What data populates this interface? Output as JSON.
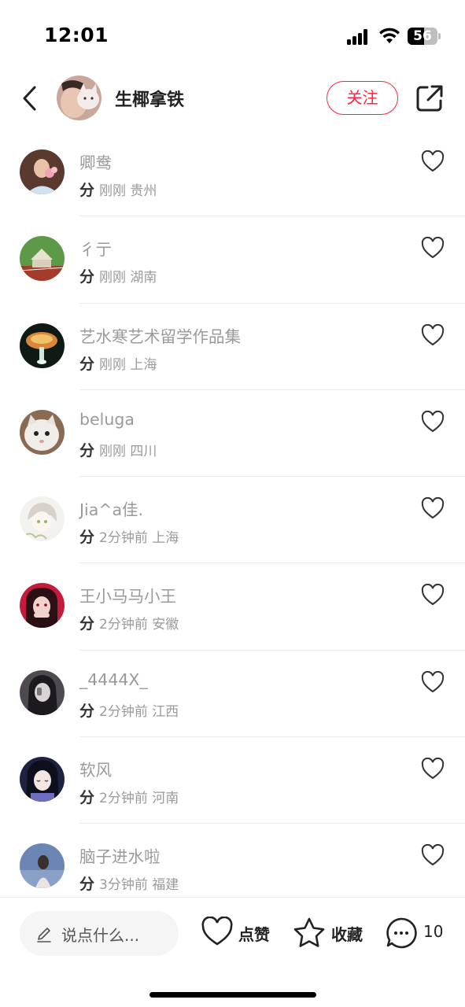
{
  "status_bar": {
    "time": "12:01",
    "battery": "56",
    "battery_level": 0.56
  },
  "header": {
    "username": "生椰拿铁",
    "follow_label": "关注"
  },
  "likes": [
    {
      "name": "卿鸯",
      "action": "分",
      "time": "刚刚",
      "location": "贵州"
    },
    {
      "name": "彳亍",
      "action": "分",
      "time": "刚刚",
      "location": "湖南"
    },
    {
      "name": "艺水寒艺术留学作品集",
      "action": "分",
      "time": "刚刚",
      "location": "上海"
    },
    {
      "name": "beluga",
      "action": "分",
      "time": "刚刚",
      "location": "四川"
    },
    {
      "name": "Jia^a佳.",
      "action": "分",
      "time": "2分钟前",
      "location": "上海"
    },
    {
      "name": "王小马马小王",
      "action": "分",
      "time": "2分钟前",
      "location": "安徽"
    },
    {
      "name": "_4444X_",
      "action": "分",
      "time": "2分钟前",
      "location": "江西"
    },
    {
      "name": "软风",
      "action": "分",
      "time": "2分钟前",
      "location": "河南"
    },
    {
      "name": "脑子进水啦",
      "action": "分",
      "time": "3分钟前",
      "location": "福建"
    }
  ],
  "bottom_bar": {
    "comment_placeholder": "说点什么...",
    "like_label": "点赞",
    "collect_label": "收藏",
    "comment_count": "10"
  },
  "colors": {
    "accent": "#ff2442",
    "secondary_text": "#9a9a9a"
  },
  "icons": [
    "chevron-left-icon",
    "share-icon",
    "heart-icon",
    "pencil-icon",
    "star-icon",
    "comment-icon"
  ]
}
